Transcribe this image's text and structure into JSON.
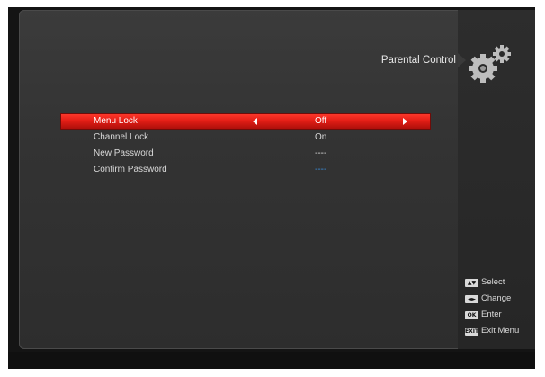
{
  "header": {
    "title": "Parental Control",
    "icon": "gears-icon"
  },
  "menu": {
    "items": [
      {
        "label": "Menu Lock",
        "value": "Off",
        "selected": true
      },
      {
        "label": "Channel Lock",
        "value": "On",
        "selected": false
      },
      {
        "label": "New Password",
        "value": "----",
        "selected": false
      },
      {
        "label": "Confirm Password",
        "value": "----",
        "selected": false
      }
    ]
  },
  "help": {
    "items": [
      {
        "key": "▲▼",
        "label": "Select"
      },
      {
        "key": "◄►",
        "label": "Change"
      },
      {
        "key": "OK",
        "label": "Enter"
      },
      {
        "key": "EXIT",
        "label": "Exit Menu"
      }
    ]
  },
  "colors": {
    "highlight": "#e51e16",
    "text": "#d9d9d9",
    "password_confirm": "#3a8ddc"
  }
}
